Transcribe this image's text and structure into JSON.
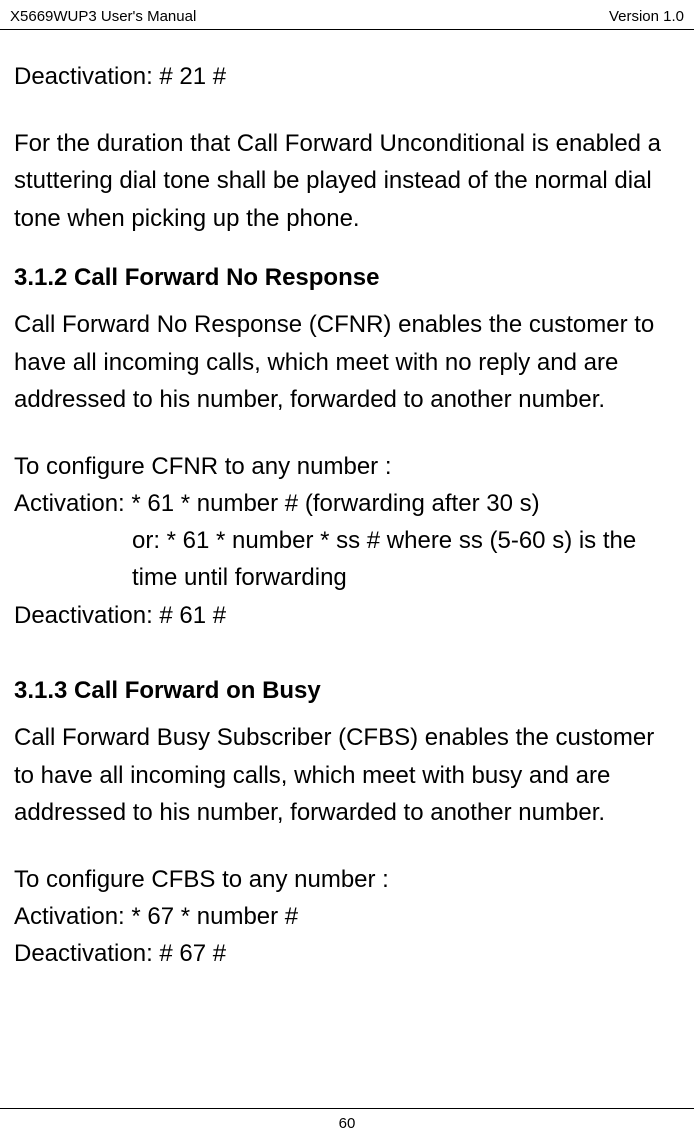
{
  "header": {
    "left": "X5669WUP3 User's Manual",
    "right": "Version 1.0"
  },
  "section_311": {
    "deactivation": "Deactivation: # 21 #",
    "note": "For the duration that Call Forward Unconditional is enabled a stuttering dial tone shall be played instead of the normal dial tone when picking up the phone."
  },
  "section_312": {
    "heading": "3.1.2 Call Forward No Response",
    "intro": "Call Forward No Response (CFNR) enables the customer to have all incoming calls, which meet with no reply and are addressed to his number, forwarded to another number.",
    "config_title": "To configure CFNR to any number :",
    "activation": "Activation: * 61 * number # (forwarding after 30 s)",
    "or_line": "or: * 61 * number * ss # where ss (5-60 s) is the time until forwarding",
    "deactivation": "Deactivation: # 61 #"
  },
  "section_313": {
    "heading": "3.1.3 Call Forward on Busy",
    "intro": "Call Forward Busy Subscriber (CFBS) enables the customer to have all incoming calls, which meet with busy and are addressed to his number, forwarded to another number.",
    "config_title": "To configure CFBS to any number :",
    "activation": "Activation: * 67 * number #",
    "deactivation": "Deactivation: # 67 #"
  },
  "footer": {
    "page_number": "60"
  }
}
